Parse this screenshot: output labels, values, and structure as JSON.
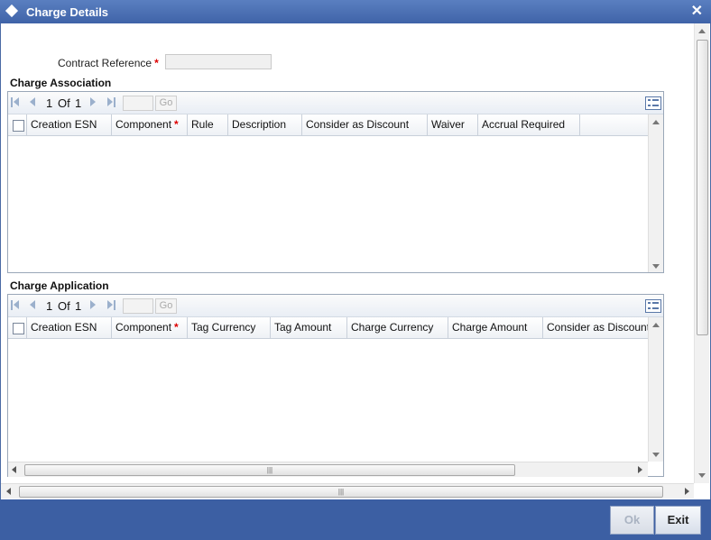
{
  "window": {
    "title": "Charge Details"
  },
  "form": {
    "contract_reference_label": "Contract Reference",
    "required_mark": "*",
    "contract_reference_value": ""
  },
  "charge_association": {
    "title": "Charge Association",
    "pager": {
      "current": "1",
      "of_label": "Of",
      "total": "1",
      "go_label": "Go"
    },
    "columns": [
      "Creation ESN",
      "Component",
      "Rule",
      "Description",
      "Consider as Discount",
      "Waiver",
      "Accrual Required"
    ]
  },
  "charge_application": {
    "title": "Charge Application",
    "pager": {
      "current": "1",
      "of_label": "Of",
      "total": "1",
      "go_label": "Go"
    },
    "columns": [
      "Creation ESN",
      "Component",
      "Tag Currency",
      "Tag Amount",
      "Charge Currency",
      "Charge Amount",
      "Consider as Discount"
    ]
  },
  "buttons": {
    "ok": "Ok",
    "exit": "Exit"
  },
  "icons": {
    "close": "close-icon",
    "title": "diamond-icon"
  },
  "colors": {
    "title_bar": "#3f63a8",
    "footer": "#3c5fa3",
    "required": "#dd0000"
  }
}
